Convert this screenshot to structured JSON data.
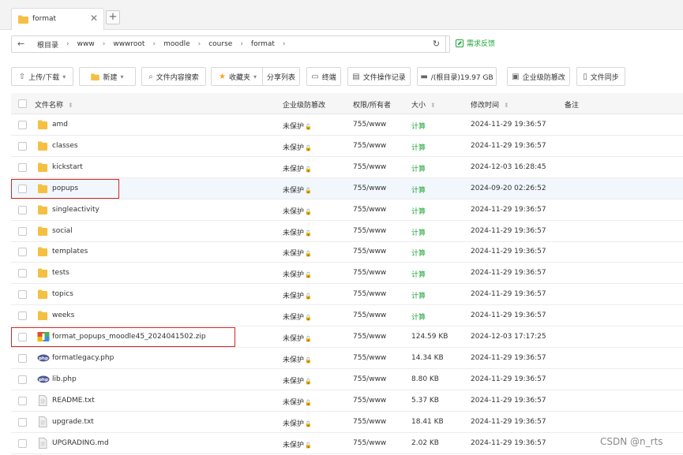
{
  "tab": {
    "label": "format",
    "close": "✕",
    "add": "+"
  },
  "path": {
    "back": "←",
    "crumbs": [
      "根目录",
      "www",
      "wwwroot",
      "moodle",
      "course",
      "format"
    ],
    "separator": "›",
    "refresh": "↻",
    "feedback": "需求反馈"
  },
  "toolbar": {
    "upload": "上传/下载",
    "new": "新建",
    "search": "文件内容搜索",
    "favorites": "收藏夹",
    "share": "分享列表",
    "terminal": "终端",
    "oplog": "文件操作记录",
    "disk": "/(根目录)19.97 GB",
    "tamper": "企业级防篡改",
    "sync": "文件同步"
  },
  "columns": {
    "name": "文件名称",
    "tamper": "企业级防篡改",
    "perm": "权限/所有者",
    "size": "大小",
    "mtime": "修改时间",
    "note": "备注"
  },
  "rows": [
    {
      "name": "amd",
      "type": "folder",
      "tamper": "未保护",
      "perm": "755/www",
      "size": "计算",
      "mtime": "2024-11-29 19:36:57"
    },
    {
      "name": "classes",
      "type": "folder",
      "tamper": "未保护",
      "perm": "755/www",
      "size": "计算",
      "mtime": "2024-11-29 19:36:57"
    },
    {
      "name": "kickstart",
      "type": "folder",
      "tamper": "未保护",
      "perm": "755/www",
      "size": "计算",
      "mtime": "2024-12-03 16:28:45"
    },
    {
      "name": "popups",
      "type": "folder",
      "tamper": "未保护",
      "perm": "755/www",
      "size": "计算",
      "mtime": "2024-09-20 02:26:52"
    },
    {
      "name": "singleactivity",
      "type": "folder",
      "tamper": "未保护",
      "perm": "755/www",
      "size": "计算",
      "mtime": "2024-11-29 19:36:57"
    },
    {
      "name": "social",
      "type": "folder",
      "tamper": "未保护",
      "perm": "755/www",
      "size": "计算",
      "mtime": "2024-11-29 19:36:57"
    },
    {
      "name": "templates",
      "type": "folder",
      "tamper": "未保护",
      "perm": "755/www",
      "size": "计算",
      "mtime": "2024-11-29 19:36:57"
    },
    {
      "name": "tests",
      "type": "folder",
      "tamper": "未保护",
      "perm": "755/www",
      "size": "计算",
      "mtime": "2024-11-29 19:36:57"
    },
    {
      "name": "topics",
      "type": "folder",
      "tamper": "未保护",
      "perm": "755/www",
      "size": "计算",
      "mtime": "2024-11-29 19:36:57"
    },
    {
      "name": "weeks",
      "type": "folder",
      "tamper": "未保护",
      "perm": "755/www",
      "size": "计算",
      "mtime": "2024-11-29 19:36:57"
    },
    {
      "name": "format_popups_moodle45_2024041502.zip",
      "type": "zip",
      "tamper": "未保护",
      "perm": "755/www",
      "size": "124.59 KB",
      "mtime": "2024-12-03 17:17:25"
    },
    {
      "name": "formatlegacy.php",
      "type": "php",
      "tamper": "未保护",
      "perm": "755/www",
      "size": "14.34 KB",
      "mtime": "2024-11-29 19:36:57"
    },
    {
      "name": "lib.php",
      "type": "php",
      "tamper": "未保护",
      "perm": "755/www",
      "size": "8.80 KB",
      "mtime": "2024-11-29 19:36:57"
    },
    {
      "name": "README.txt",
      "type": "text",
      "tamper": "未保护",
      "perm": "755/www",
      "size": "5.37 KB",
      "mtime": "2024-11-29 19:36:57"
    },
    {
      "name": "upgrade.txt",
      "type": "text",
      "tamper": "未保护",
      "perm": "755/www",
      "size": "18.41 KB",
      "mtime": "2024-11-29 19:36:57"
    },
    {
      "name": "UPGRADING.md",
      "type": "text",
      "tamper": "未保护",
      "perm": "755/www",
      "size": "2.02 KB",
      "mtime": "2024-11-29 19:36:57"
    }
  ],
  "highlight_row": "popups",
  "marked_rows": [
    "popups",
    "format_popups_moodle45_2024041502.zip"
  ],
  "watermark": "CSDN @n_rts",
  "colors": {
    "accent": "#20a53a",
    "marker": "#d9251d",
    "folder": "#f5c042"
  }
}
